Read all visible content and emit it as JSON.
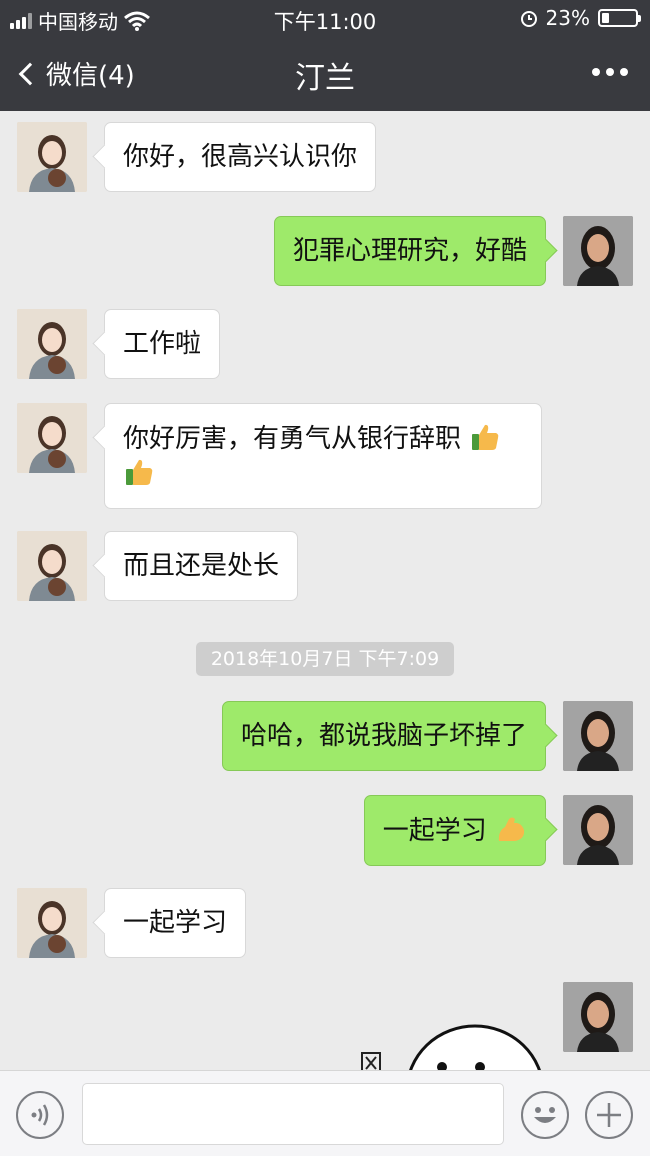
{
  "status_bar": {
    "carrier": "中国移动",
    "time": "下午11:00",
    "battery": "23%",
    "battery_level": 0.23
  },
  "nav": {
    "back_label": "微信(4)",
    "title": "汀兰"
  },
  "messages": [
    {
      "from": "other",
      "text": "你好，很高兴认识你"
    },
    {
      "from": "me",
      "text": "犯罪心理研究，好酷"
    },
    {
      "from": "other",
      "text": "工作啦"
    },
    {
      "from": "other",
      "text": "你好厉害，有勇气从银行辞职"
    },
    {
      "from": "other",
      "text": "而且还是处长"
    },
    {
      "from": "me",
      "text": "哈哈，都说我脑子坏掉了"
    },
    {
      "from": "me",
      "text": "一起学习"
    },
    {
      "from": "other",
      "text": "一起学习"
    }
  ],
  "timestamp": "2018年10月7日 下午7:09",
  "icons": {
    "thumbs_up": "thumbs-up-icon",
    "flexed_biceps": "flexed-biceps-icon"
  }
}
